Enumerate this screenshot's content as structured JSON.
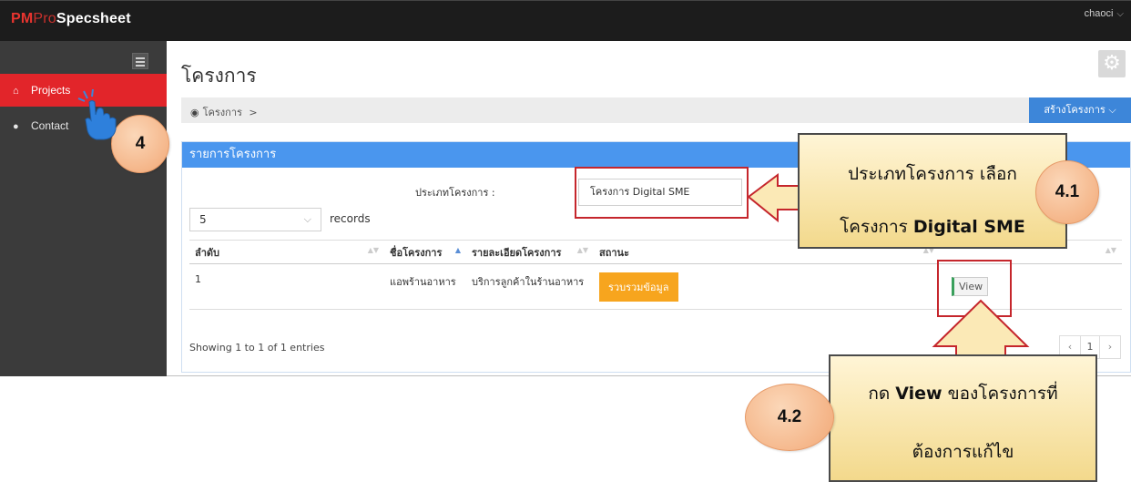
{
  "app": {
    "brand_part1": "PM",
    "brand_part2": "Pro",
    "brand_part3": "Specsheet",
    "user": "chaoci"
  },
  "sidebar": {
    "items": [
      {
        "label": "Projects",
        "icon": "home-icon",
        "active": true
      },
      {
        "label": "Contact",
        "icon": "user-icon",
        "active": false
      }
    ]
  },
  "page": {
    "title": "โครงการ",
    "breadcrumb": "โครงการ",
    "breadcrumb_sep": ">",
    "create_button": "สร้างโครงการ"
  },
  "panel": {
    "title": "รายการโครงการ",
    "filter_label": "ประเภทโครงการ :",
    "filter_value": "โครงการ Digital SME",
    "page_length": "5",
    "page_length_label": "records",
    "columns": [
      "ลำดับ",
      "ชื่อโครงการ",
      "รายละเอียดโครงการ",
      "สถานะ",
      ""
    ],
    "rows": [
      {
        "index": "1",
        "name": "แอพร้านอาหาร",
        "detail": "บริการลูกค้าในร้านอาหาร",
        "status": "รวบรวมข้อมูล",
        "action": "View"
      }
    ],
    "showing": "Showing 1 to 1 of 1 entries",
    "pager": {
      "prev": "‹",
      "current": "1",
      "next": "›"
    }
  },
  "annotations": {
    "step4": "4",
    "step41": "4.1",
    "step42": "4.2",
    "callout_filter_line1": "ประเภทโครงการ เลือก",
    "callout_filter_line2_a": "โครงการ ",
    "callout_filter_line2_b": "Digital SME",
    "callout_view_line1_a": "กด ",
    "callout_view_line1_b": "View",
    "callout_view_line1_c": " ของโครงการที่",
    "callout_view_line2": "ต้องการแก้ไข"
  },
  "colors": {
    "topbar": "#1c1c1c",
    "sidebar": "#3b3b3b",
    "active": "#e2252a",
    "panel_head": "#4a96ee",
    "status": "#f7a51e",
    "callout_border": "#c5262c"
  }
}
